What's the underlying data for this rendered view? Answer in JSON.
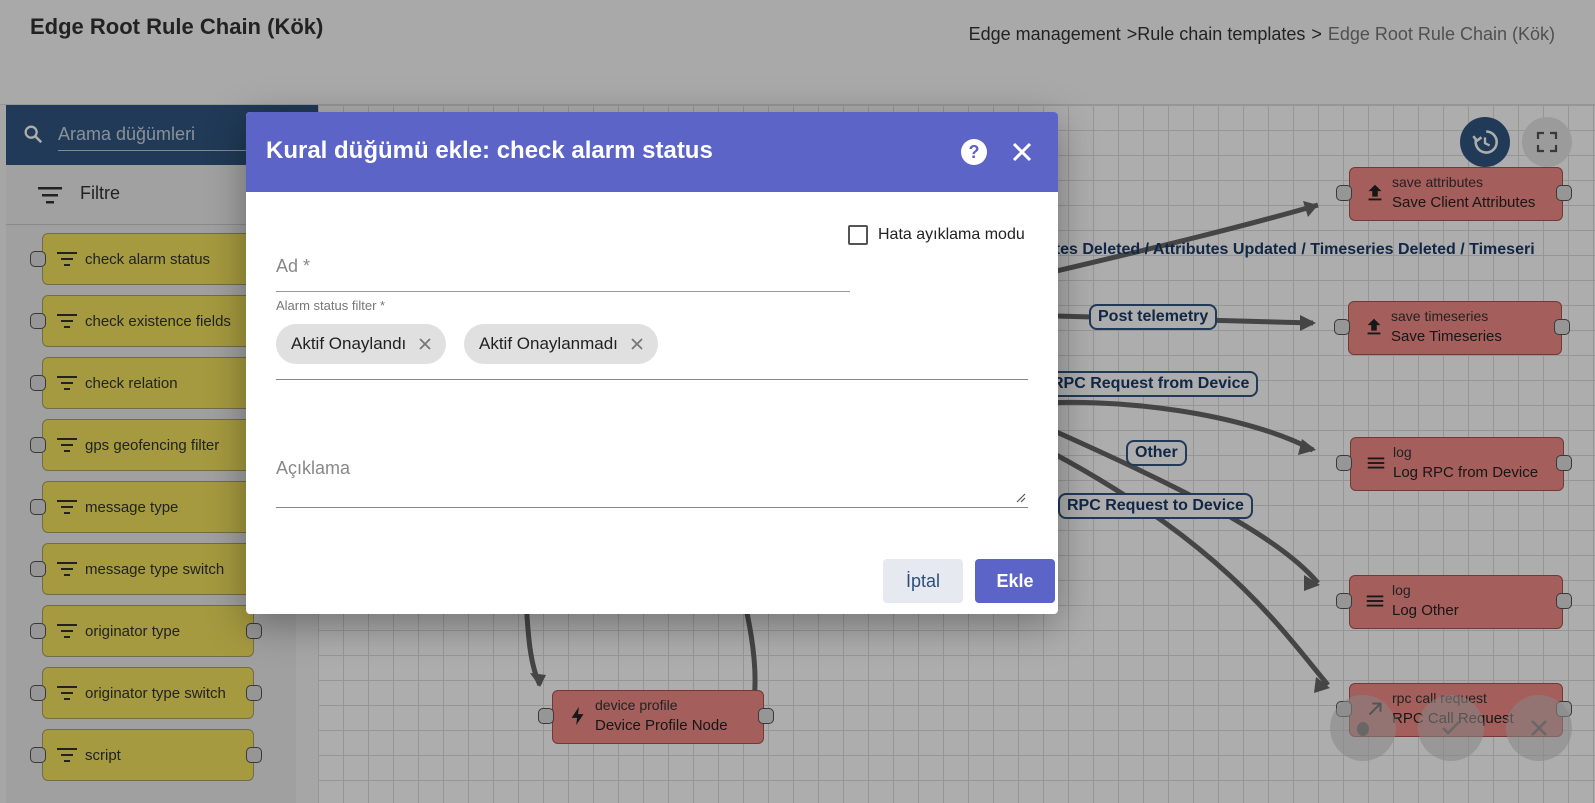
{
  "header": {
    "title": "Edge Root Rule Chain (Kök)",
    "breadcrumb": [
      "Edge management",
      ">Rule chain templates",
      ">",
      "Edge Root Rule Chain (Kök)"
    ]
  },
  "sidebar": {
    "search_placeholder": "Arama düğümleri",
    "filter_label": "Filtre",
    "items": [
      {
        "label": "check alarm status"
      },
      {
        "label": "check existence fields"
      },
      {
        "label": "check relation"
      },
      {
        "label": "gps geofencing filter"
      },
      {
        "label": "message type"
      },
      {
        "label": "message type switch"
      },
      {
        "label": "originator type"
      },
      {
        "label": "originator type switch"
      },
      {
        "label": "script"
      }
    ]
  },
  "canvas": {
    "nodes": [
      {
        "type": "save attributes",
        "name": "Save Client Attributes",
        "icon": "upload-icon"
      },
      {
        "type": "save timeseries",
        "name": "Save Timeseries",
        "icon": "upload-icon"
      },
      {
        "type": "log",
        "name": "Log RPC from Device",
        "icon": "menu-icon"
      },
      {
        "type": "log",
        "name": "Log Other",
        "icon": "menu-icon"
      },
      {
        "type": "rpc call request",
        "name": "RPC Call Request",
        "icon": "arrow-up-right-icon"
      },
      {
        "type": "device profile",
        "name": "Device Profile Node",
        "icon": "bolt-icon"
      }
    ],
    "edge_labels": [
      "utes Deleted / Attributes Updated / Timeseries Deleted / Timeseri",
      "Post telemetry",
      "RPC Request from Device",
      "Other",
      "RPC Request to Device"
    ]
  },
  "dialog": {
    "title": "Kural düğümü ekle: check alarm status",
    "debug_label": "Hata ayıklama modu",
    "name_placeholder": "Ad *",
    "filter_label": "Alarm status filter *",
    "chips": [
      "Aktif Onaylandı",
      "Aktif Onaylanmadı"
    ],
    "description_placeholder": "Açıklama",
    "cancel_label": "İptal",
    "add_label": "Ekle"
  },
  "colors": {
    "dialog_header": "#5c65c7",
    "search_bar": "#305680",
    "filter_node": "#f3e35e",
    "action_node": "#f28b86"
  }
}
